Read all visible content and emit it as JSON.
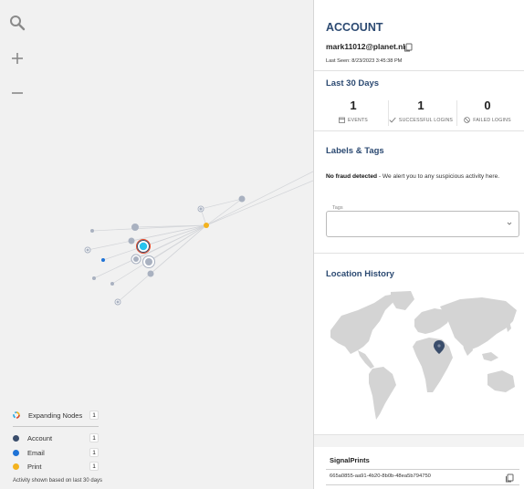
{
  "toolbar": {
    "search_icon": "search-icon",
    "zoom_in_icon": "plus-icon",
    "zoom_out_icon": "minus-icon"
  },
  "legend": {
    "expanding_nodes": {
      "label": "Expanding Nodes",
      "count": "1"
    },
    "items": [
      {
        "label": "Account",
        "count": "1",
        "color": "#3a4d6b"
      },
      {
        "label": "Email",
        "count": "1",
        "color": "#1f73d6"
      },
      {
        "label": "Print",
        "count": "1",
        "color": "#f3b21e"
      }
    ],
    "note": "Activity shown based on last 30 days"
  },
  "account": {
    "title": "ACCOUNT",
    "email": "mark11012@planet.nl",
    "last_seen": "Last Seen: 8/23/2023 3:45:38 PM"
  },
  "last30": {
    "title": "Last 30 Days",
    "stats": [
      {
        "value": "1",
        "label": "EVENTS"
      },
      {
        "value": "1",
        "label": "SUCCESSFUL LOGINS"
      },
      {
        "value": "0",
        "label": "FAILED LOGINS"
      }
    ]
  },
  "labels": {
    "title": "Labels & Tags",
    "fraud_bold": "No fraud detected",
    "fraud_rest": " - We alert you to any suspicious activity here.",
    "tags_label": "Tags"
  },
  "location": {
    "title": "Location History"
  },
  "signalprints": {
    "title": "SignalPrints",
    "rows": [
      "665a0855-aa91-4b20-8b0b-48ea5b794750"
    ]
  },
  "colors": {
    "accent": "#2c4a72",
    "node_gray": "#a9b1c0",
    "print": "#f3b21e",
    "selected": "#27c3ee"
  }
}
